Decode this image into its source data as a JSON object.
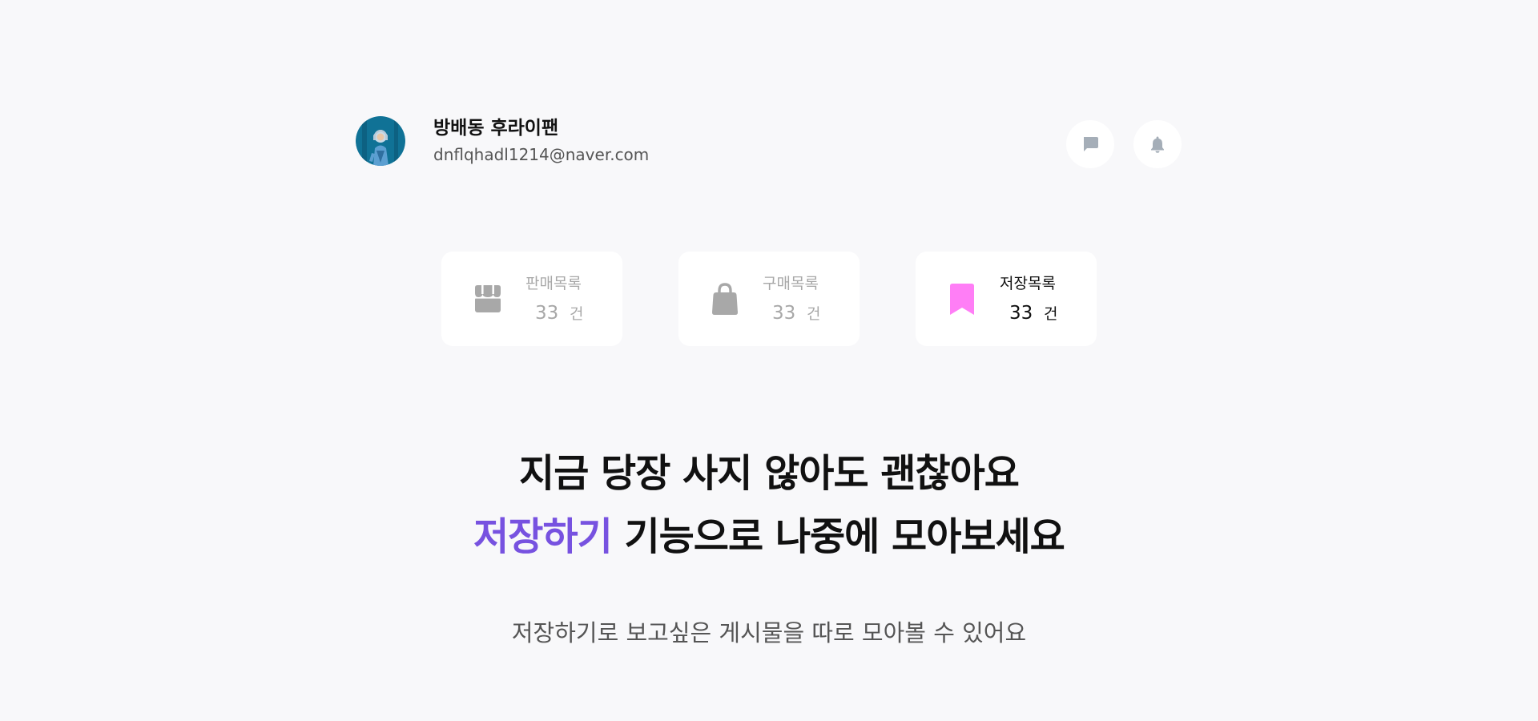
{
  "profile": {
    "name": "방배동 후라이팬",
    "email": "dnflqhadl1214@naver.com"
  },
  "actions": {
    "chat_icon": "chat-icon",
    "bell_icon": "bell-icon"
  },
  "stats": [
    {
      "label": "판매목록",
      "count": "33",
      "unit": "건",
      "icon": "store-icon",
      "active": false
    },
    {
      "label": "구매목록",
      "count": "33",
      "unit": "건",
      "icon": "shopping-bag-icon",
      "active": false
    },
    {
      "label": "저장목록",
      "count": "33",
      "unit": "건",
      "icon": "bookmark-icon",
      "active": true
    }
  ],
  "headline": {
    "line1": "지금 당장 사지 않아도 괜찮아요",
    "line2_accent": "저장하기",
    "line2_rest": " 기능으로 나중에 모아보세요"
  },
  "subtitle": "저장하기로 보고싶은 게시물을 따로 모아볼 수 있어요",
  "colors": {
    "background": "#f8f8fa",
    "accent": "#7752e0",
    "bookmark": "#ff7ef6",
    "inactive_icon": "#a8a8a8",
    "header_icon": "#a5aeb8"
  }
}
